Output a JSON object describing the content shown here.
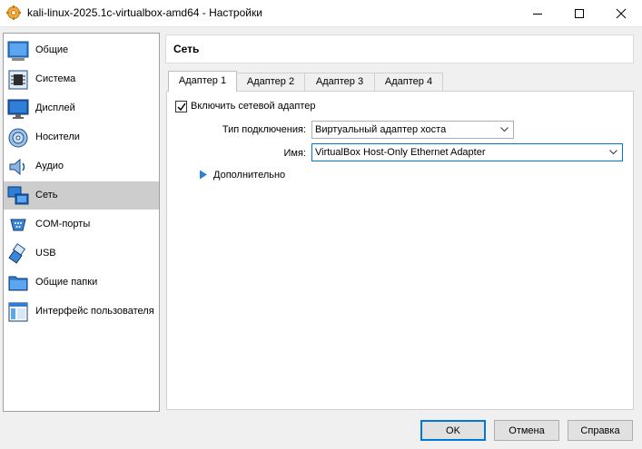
{
  "window": {
    "title": "kali-linux-2025.1c-virtualbox-amd64 - Настройки"
  },
  "sidebar": {
    "items": [
      {
        "label": "Общие",
        "icon": "general-icon"
      },
      {
        "label": "Система",
        "icon": "system-chip-icon"
      },
      {
        "label": "Дисплей",
        "icon": "monitor-icon"
      },
      {
        "label": "Носители",
        "icon": "storage-disc-icon"
      },
      {
        "label": "Аудио",
        "icon": "speaker-icon"
      },
      {
        "label": "Сеть",
        "icon": "network-icon",
        "selected": true
      },
      {
        "label": "COM-порты",
        "icon": "serial-port-icon"
      },
      {
        "label": "USB",
        "icon": "usb-icon"
      },
      {
        "label": "Общие папки",
        "icon": "folder-icon"
      },
      {
        "label": "Интерфейс пользователя",
        "icon": "user-interface-icon"
      }
    ]
  },
  "header": {
    "title": "Сеть"
  },
  "tabs": [
    {
      "label": "Адаптер 1",
      "active": true
    },
    {
      "label": "Адаптер 2"
    },
    {
      "label": "Адаптер 3"
    },
    {
      "label": "Адаптер 4"
    }
  ],
  "adapter": {
    "enable_label": "Включить сетевой адаптер",
    "enabled": true,
    "attachment_label": "Тип подключения:",
    "attachment_value": "Виртуальный адаптер хоста",
    "name_label": "Имя:",
    "name_value": "VirtualBox Host-Only Ethernet Adapter",
    "advanced_label": "Дополнительно"
  },
  "buttons": {
    "ok": "OK",
    "cancel": "Отмена",
    "help": "Справка"
  },
  "colors": {
    "accent": "#0078d7",
    "selected_bg": "#cdcdcd"
  }
}
